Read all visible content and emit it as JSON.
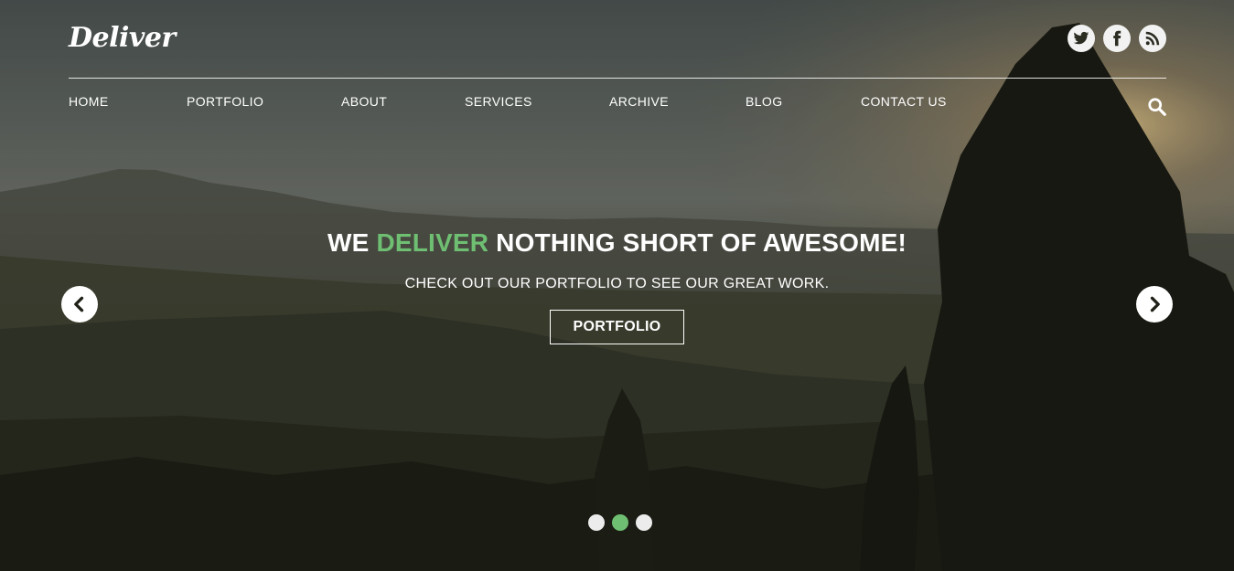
{
  "brand": {
    "logo_text": "Deliver"
  },
  "social": [
    {
      "icon": "twitter-icon"
    },
    {
      "icon": "facebook-icon"
    },
    {
      "icon": "rss-icon"
    }
  ],
  "nav": {
    "items": [
      {
        "label": "HOME"
      },
      {
        "label": "PORTFOLIO"
      },
      {
        "label": "ABOUT"
      },
      {
        "label": "SERVICES"
      },
      {
        "label": "ARCHIVE"
      },
      {
        "label": "BLOG"
      },
      {
        "label": "CONTACT US"
      }
    ],
    "search_icon": "search-icon"
  },
  "hero": {
    "title_prefix": "WE ",
    "title_accent": "DELIVER",
    "title_suffix": " NOTHING SHORT OF AWESOME!",
    "subtitle": "CHECK OUT OUR PORTFOLIO TO SEE OUR GREAT WORK.",
    "cta_label": "PORTFOLIO"
  },
  "slider": {
    "slide_count": 3,
    "active_index": 1,
    "prev_icon": "chevron-left-icon",
    "next_icon": "chevron-right-icon"
  },
  "colors": {
    "accent": "#6fbf73",
    "text": "#ffffff"
  }
}
